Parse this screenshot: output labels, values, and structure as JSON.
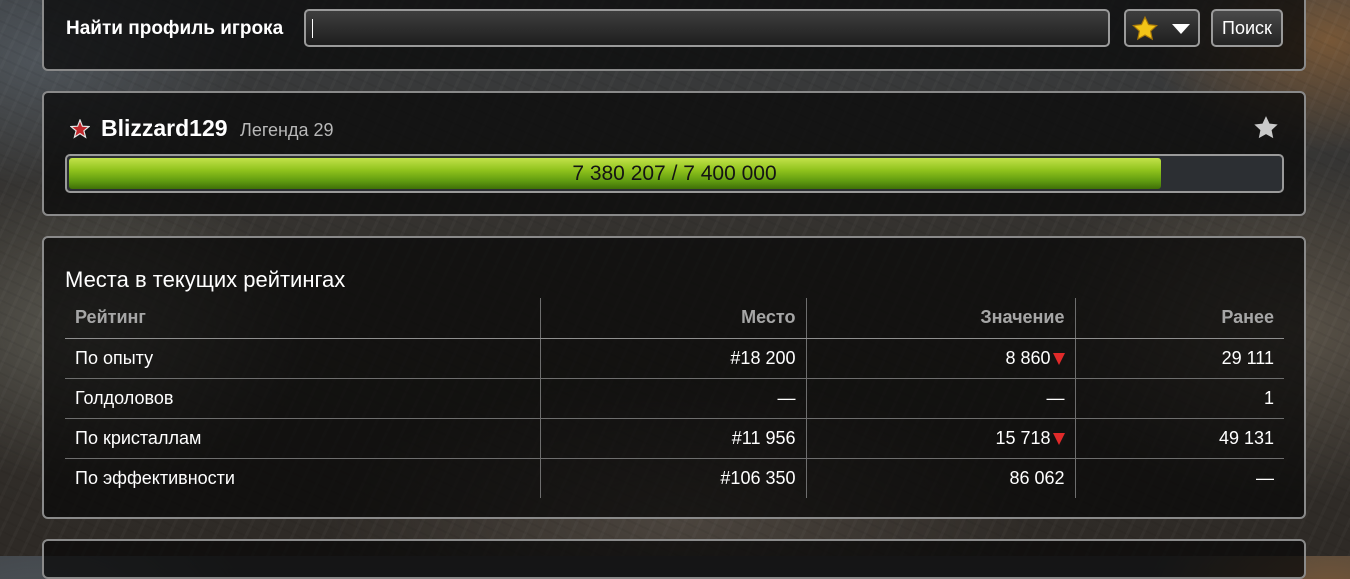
{
  "search": {
    "label": "Найти профиль игрока",
    "value": "",
    "button_label": "Поиск"
  },
  "profile": {
    "name": "Blizzard129",
    "rank": "Легенда 29",
    "experience_text": "7 380 207 / 7 400 000",
    "experience_current": 7380207,
    "experience_total": 7400000
  },
  "ratings": {
    "title": "Места в текущих рейтингах",
    "headers": [
      "Рейтинг",
      "Место",
      "Значение",
      "Ранее"
    ],
    "rows": [
      {
        "name": "По опыту",
        "place": "#18 200",
        "value": "8 860",
        "trend": "down",
        "previous": "29 111"
      },
      {
        "name": "Голдоловов",
        "place": "—",
        "value": "—",
        "trend": "",
        "previous": "1"
      },
      {
        "name": "По кристаллам",
        "place": "#11 956",
        "value": "15 718",
        "trend": "down",
        "previous": "49 131"
      },
      {
        "name": "По эффективности",
        "place": "#106 350",
        "value": "86 062",
        "trend": "",
        "previous": "—"
      }
    ]
  },
  "icons": {
    "favorites_dropdown": "star-icon",
    "dropdown_arrow": "chevron-down-icon",
    "rank": "rank-insignia-icon",
    "favorite_toggle": "star-icon",
    "trend_down": "down-triangle-icon"
  },
  "colors": {
    "progress_fill": "#8fc21c",
    "trend_down": "#e02a2a",
    "favorite_star": "#f2c417",
    "rank_icon": "#c0282c"
  }
}
